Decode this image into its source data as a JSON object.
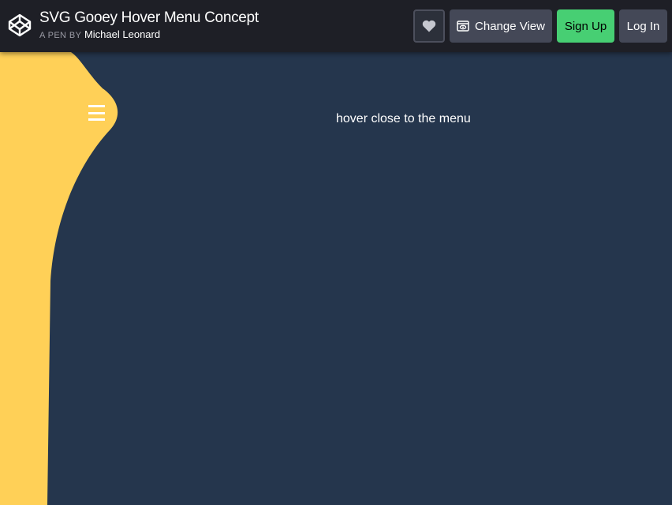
{
  "header": {
    "title": "SVG Gooey Hover Menu Concept",
    "byline_prefix": "A PEN BY",
    "author": "Michael Leonard",
    "logo_icon": "codepen-cube-icon",
    "heart_icon": "heart-icon",
    "change_view_icon": "eye-window-icon",
    "change_view_label": "Change View",
    "signup_label": "Sign Up",
    "login_label": "Log In"
  },
  "stage": {
    "hint_text": "hover close to the menu",
    "menu_icon": "hamburger-menu-icon",
    "blob_color": "#ffd057",
    "background_color": "#25364d"
  },
  "colors": {
    "topbar": "#1e1f26",
    "button": "#444857",
    "signup_green": "#47cf73"
  }
}
